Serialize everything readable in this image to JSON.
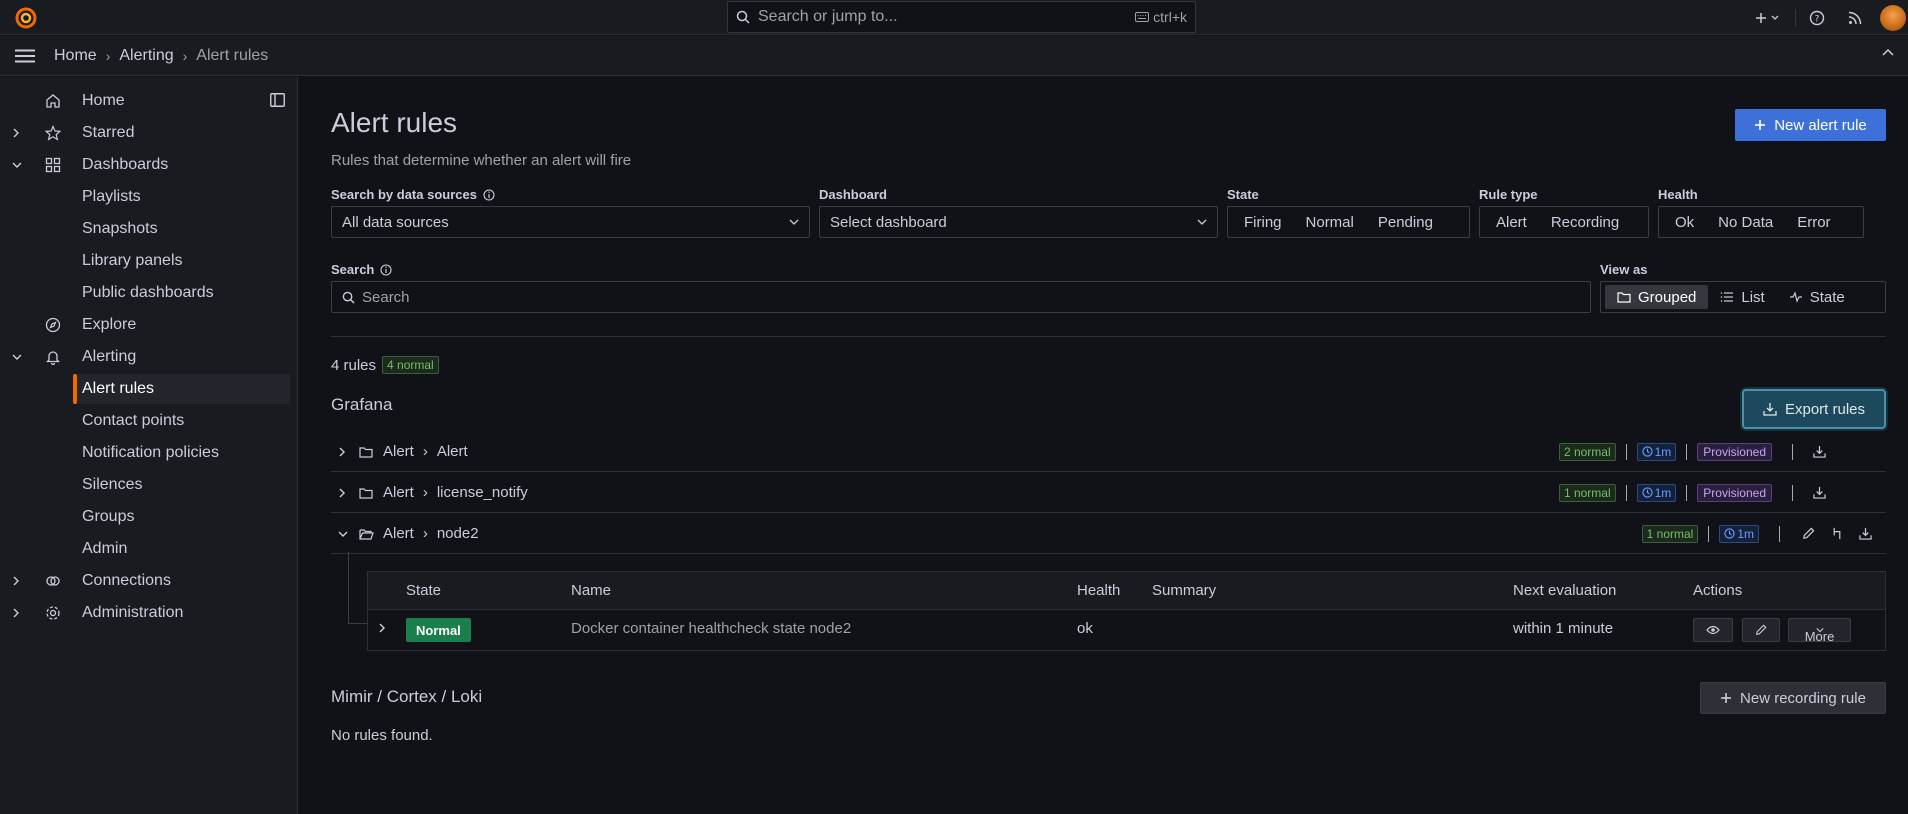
{
  "topbar": {
    "search_placeholder": "Search or jump to...",
    "search_shortcut": "ctrl+k"
  },
  "breadcrumb": [
    "Home",
    "Alerting",
    "Alert rules"
  ],
  "sidebar": {
    "items": [
      {
        "label": "Home",
        "icon": "home-icon",
        "chevron": ""
      },
      {
        "label": "Starred",
        "icon": "star-icon",
        "chevron": "right"
      },
      {
        "label": "Dashboards",
        "icon": "apps-icon",
        "chevron": "down"
      },
      {
        "label": "Playlists"
      },
      {
        "label": "Snapshots"
      },
      {
        "label": "Library panels"
      },
      {
        "label": "Public dashboards"
      },
      {
        "label": "Explore",
        "icon": "compass-icon",
        "chevron": ""
      },
      {
        "label": "Alerting",
        "icon": "bell-icon",
        "chevron": "down"
      },
      {
        "label": "Alert rules",
        "active": true
      },
      {
        "label": "Contact points"
      },
      {
        "label": "Notification policies"
      },
      {
        "label": "Silences"
      },
      {
        "label": "Groups"
      },
      {
        "label": "Admin"
      },
      {
        "label": "Connections",
        "icon": "connections-icon",
        "chevron": "right"
      },
      {
        "label": "Administration",
        "icon": "cog-icon",
        "chevron": "right"
      }
    ]
  },
  "page": {
    "title": "Alert rules",
    "subtitle": "Rules that determine whether an alert will fire",
    "new_rule_label": "New alert rule"
  },
  "filters": {
    "datasource_label": "Search by data sources",
    "datasource_value": "All data sources",
    "dashboard_label": "Dashboard",
    "dashboard_placeholder": "Select dashboard",
    "state_label": "State",
    "state_options": [
      "Firing",
      "Normal",
      "Pending"
    ],
    "ruletype_label": "Rule type",
    "ruletype_options": [
      "Alert",
      "Recording"
    ],
    "health_label": "Health",
    "health_options": [
      "Ok",
      "No Data",
      "Error"
    ],
    "search_label": "Search",
    "search_placeholder": "Search",
    "viewas_label": "View as",
    "viewas_options": [
      "Grouped",
      "List",
      "State"
    ],
    "viewas_selected": "Grouped"
  },
  "summary": {
    "count_text": "4 rules",
    "normal_badge": "4 normal"
  },
  "grafana_section": {
    "title": "Grafana",
    "export_label": "Export rules",
    "groups": [
      {
        "folder": "Alert",
        "name": "Alert",
        "normal": "2 normal",
        "interval": "1m",
        "provisioned": "Provisioned",
        "expanded": false
      },
      {
        "folder": "Alert",
        "name": "license_notify",
        "normal": "1 normal",
        "interval": "1m",
        "provisioned": "Provisioned",
        "expanded": false
      },
      {
        "folder": "Alert",
        "name": "node2",
        "normal": "1 normal",
        "interval": "1m",
        "provisioned": "",
        "expanded": true
      }
    ],
    "table": {
      "headers": [
        "State",
        "Name",
        "Health",
        "Summary",
        "Next evaluation",
        "Actions"
      ],
      "row": {
        "state": "Normal",
        "name": "Docker container healthcheck state node2",
        "health": "ok",
        "summary": "",
        "next_eval": "within 1 minute",
        "more_label": "More"
      }
    }
  },
  "mimir_section": {
    "title": "Mimir / Cortex / Loki",
    "new_recording_label": "New recording rule",
    "empty_text": "No rules found."
  },
  "colors": {
    "accent": "#f46800",
    "primary": "#3d71d9",
    "normal_green": "#1a7f4b"
  }
}
